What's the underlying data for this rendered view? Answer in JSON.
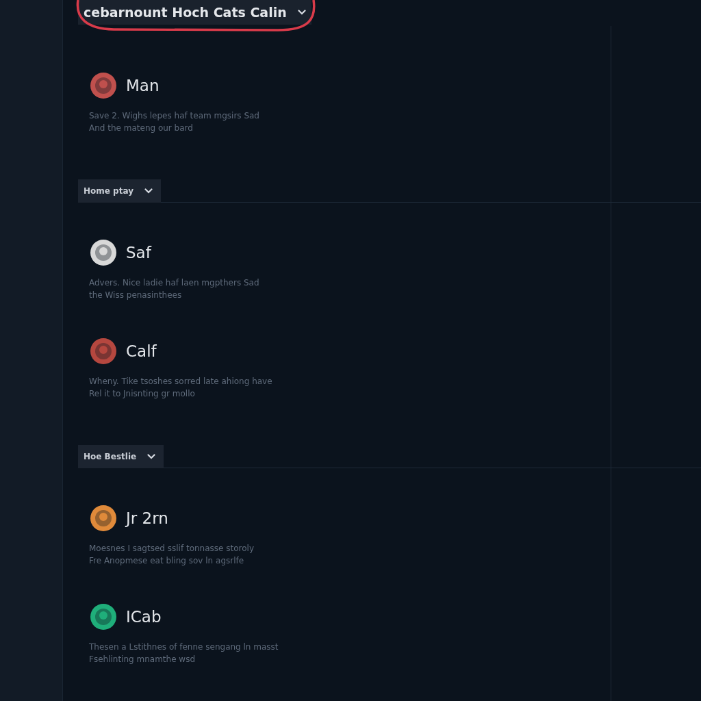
{
  "header_dropdown": {
    "label": "cebarnount Hoch Cats Calin",
    "annotated": true
  },
  "entries": [
    {
      "kind": "item",
      "name": "Man",
      "color": "#c0504d",
      "description": "Save 2. Wighs lepes haf team mgsirs Sad",
      "description_2": "And the mateng our bard"
    },
    {
      "kind": "dropdown",
      "label": "Home ptay"
    },
    {
      "kind": "item",
      "name": "Saf",
      "color": "#d8d8d8",
      "description": "Advers. Nice ladie haf laen mgpthers Sad",
      "description_2": "the Wiss penasinthees"
    },
    {
      "kind": "item",
      "name": "Calf",
      "color": "#b5473f",
      "description": "Wheny. Tike tsoshes sorred late ahiong have",
      "description_2": "Rel it to Jnisnting gr mollo"
    },
    {
      "kind": "dropdown",
      "label": "Hoe Bestlie"
    },
    {
      "kind": "item",
      "name": "Jr 2rn",
      "color": "#e08a3a",
      "description": "Moesnes I sagtsed sslif tonnasse storoly",
      "description_2": "Fre Anopmese eat bling sov ln agsrlfe"
    },
    {
      "kind": "item",
      "name": "ICab",
      "color": "#1fae7a",
      "description": "Thesen a Lstithnes of fenne sengang ln masst",
      "description_2": "Fsehlinting mnamthe wsd"
    }
  ]
}
